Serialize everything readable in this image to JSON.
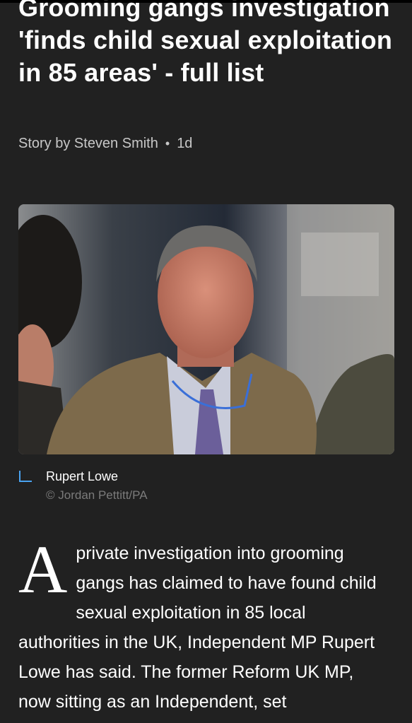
{
  "article": {
    "headline": "Grooming gangs investigation 'finds child sexual exploitation in 85 areas' - full list",
    "byline": {
      "author": "Story by Steven Smith",
      "separator": "•",
      "age": "1d"
    },
    "image": {
      "caption": "Rupert Lowe",
      "credit": "© Jordan Pettitt/PA"
    },
    "body": {
      "dropcap": "A",
      "text": " private investigation into grooming gangs has claimed to have found child sexual exploitation in 85 local authorities in the UK, Independent MP Rupert Lowe has said. The former Reform UK MP, now sitting as an Independent, set"
    }
  },
  "colors": {
    "background": "#212121",
    "caption_accent": "#4aa3f0",
    "credit_text": "#7b7b7b"
  },
  "icons": [
    "caption-corner-icon"
  ]
}
